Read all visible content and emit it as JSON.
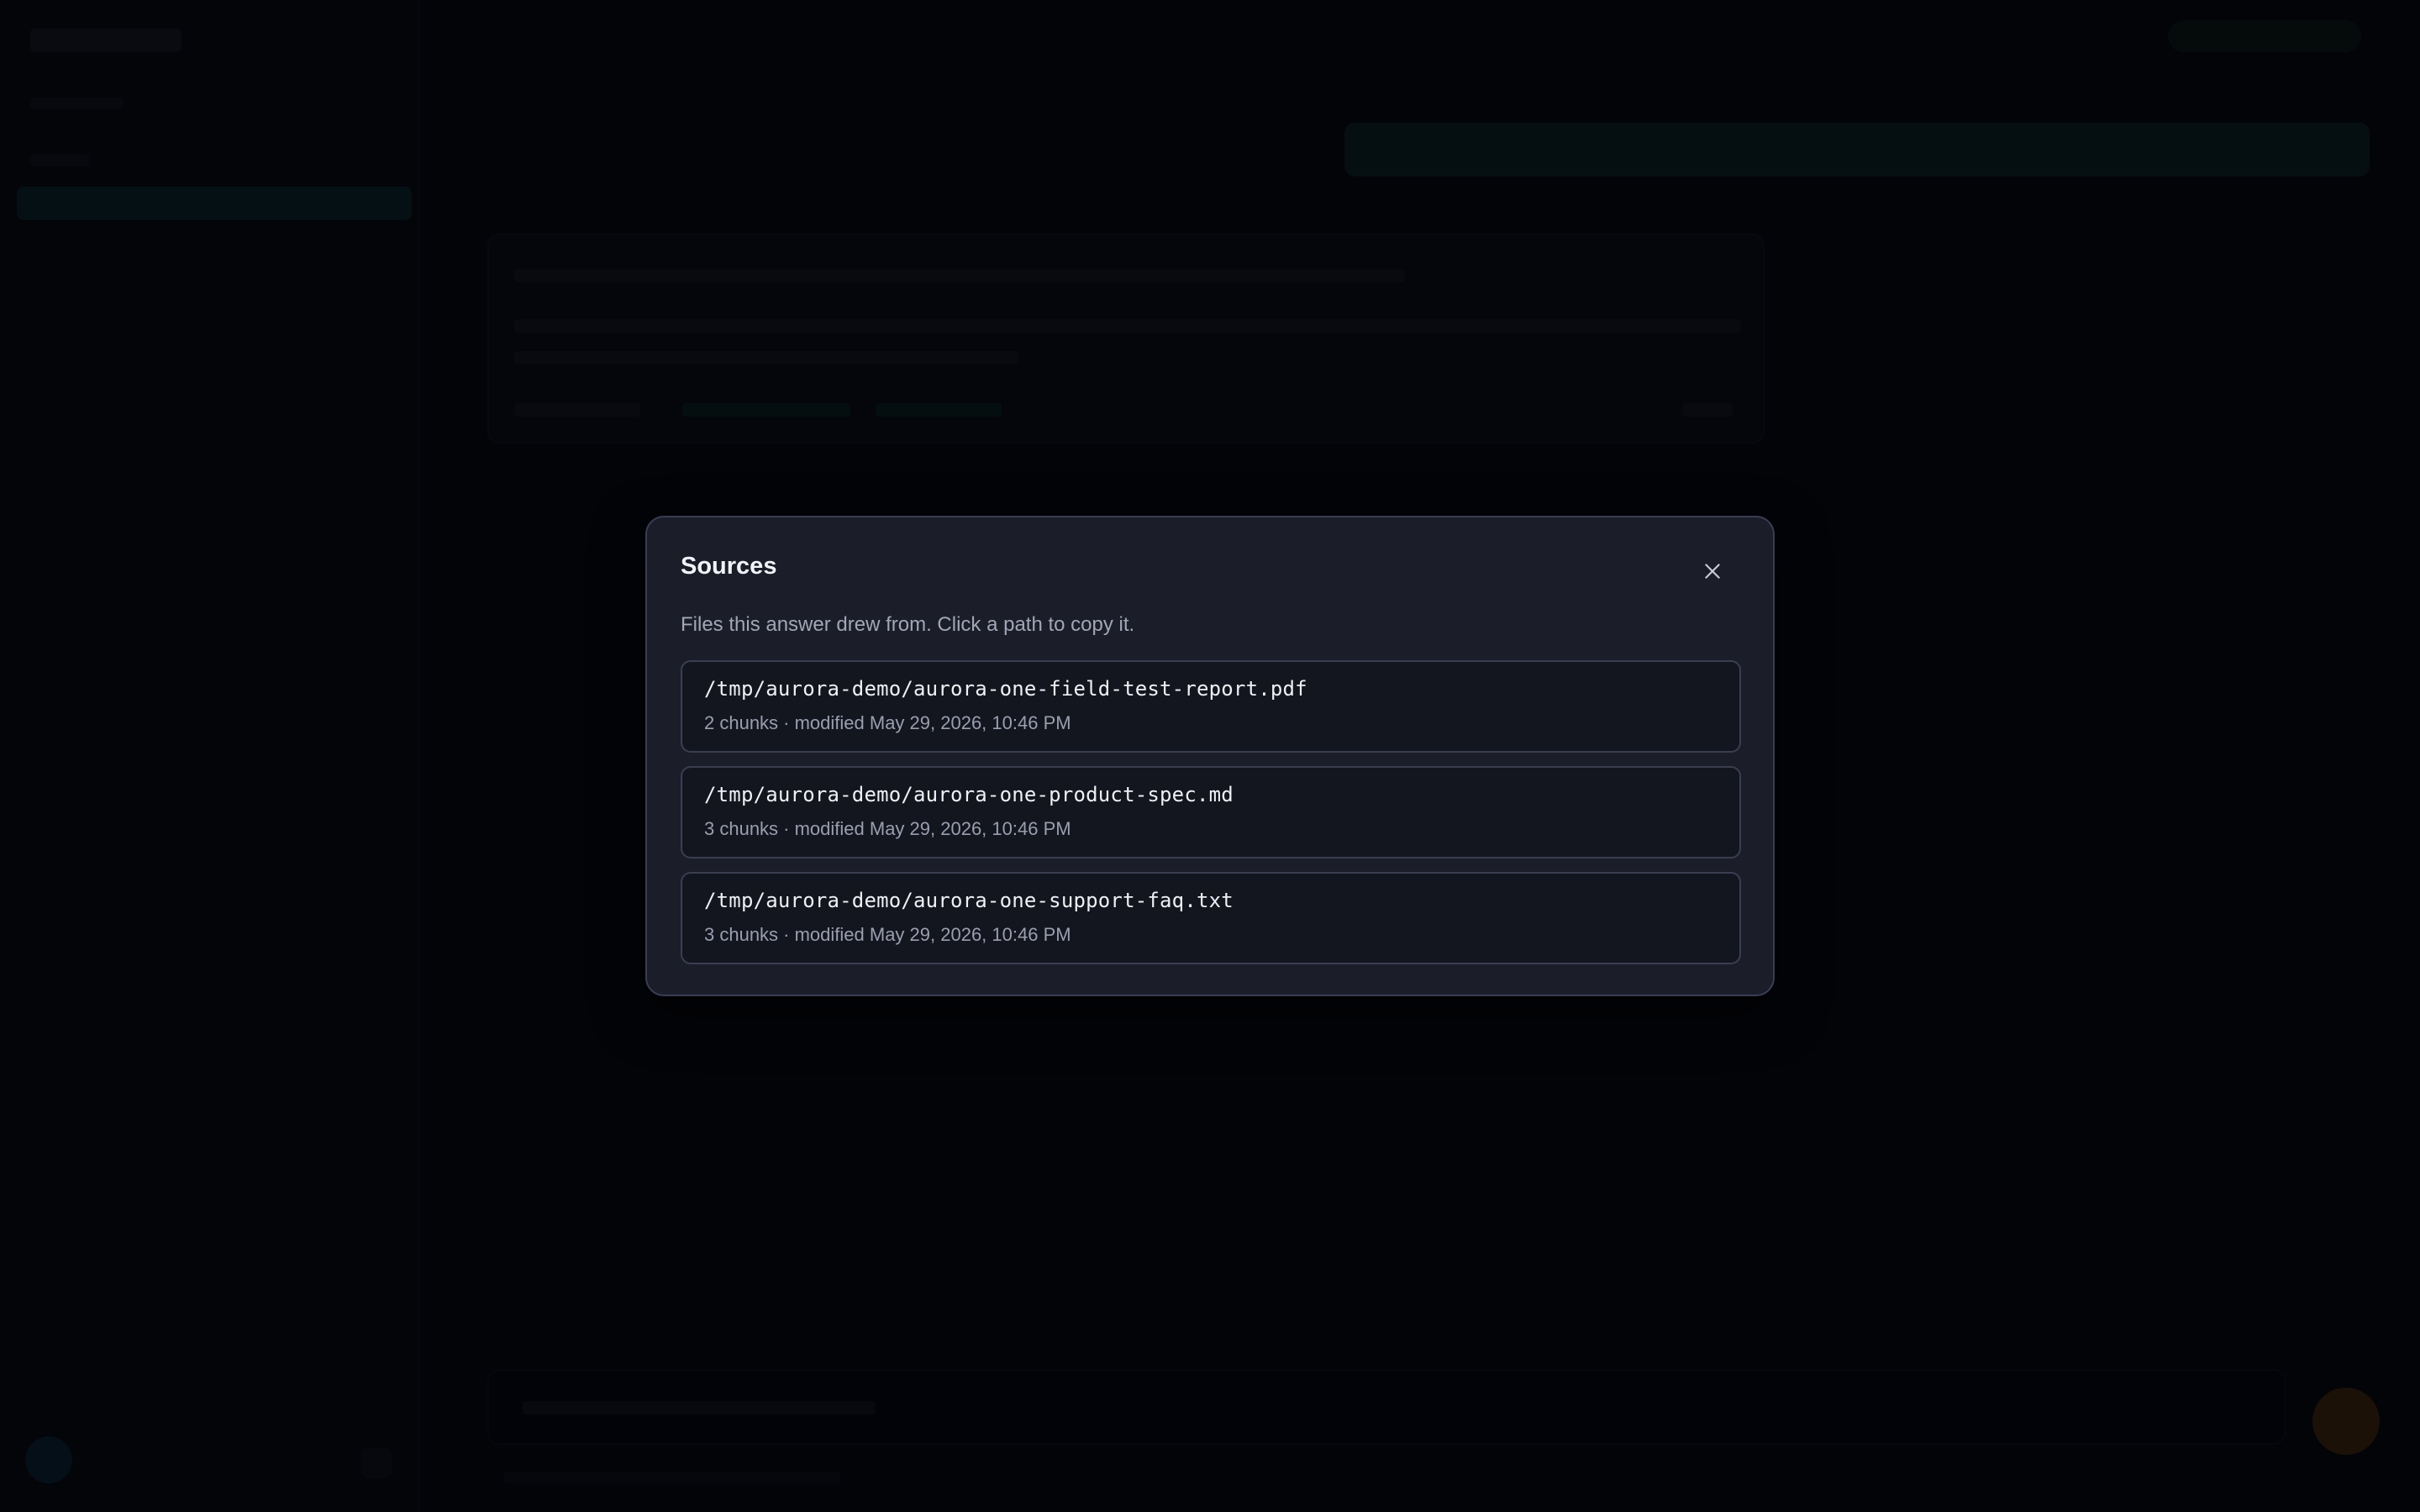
{
  "modal": {
    "title": "Sources",
    "description": "Files this answer drew from. Click a path to copy it.",
    "close_icon": "close-icon",
    "sources": [
      {
        "path": "/tmp/aurora-demo/aurora-one-field-test-report.pdf",
        "meta": "2 chunks · modified May 29, 2026, 10:46 PM"
      },
      {
        "path": "/tmp/aurora-demo/aurora-one-product-spec.md",
        "meta": "3 chunks · modified May 29, 2026, 10:46 PM"
      },
      {
        "path": "/tmp/aurora-demo/aurora-one-support-faq.txt",
        "meta": "3 chunks · modified May 29, 2026, 10:46 PM"
      }
    ]
  },
  "colors": {
    "modal_bg": "#1b1d28",
    "modal_border": "#3a3d55",
    "item_bg": "#14161f",
    "accent_teal": "#0b1f26",
    "send_orange": "#3a2208"
  }
}
